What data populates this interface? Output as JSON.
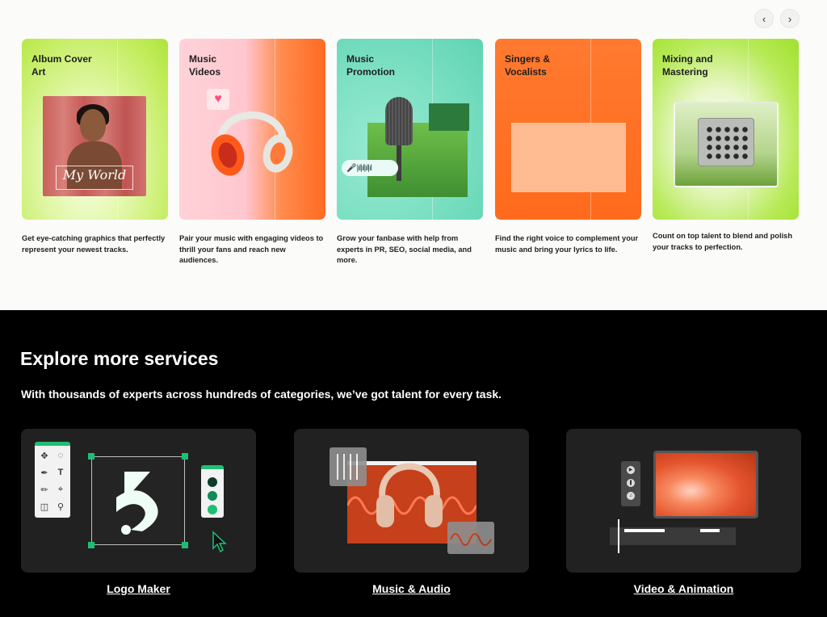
{
  "carousel": {
    "prev_icon": "chevron-left-icon",
    "next_icon": "chevron-right-icon",
    "cards": [
      {
        "title_line1": "Album Cover",
        "title_line2": "Art",
        "art_text": "My World",
        "description": "Get eye-catching graphics that perfectly represent your newest tracks."
      },
      {
        "title_line1": "Music",
        "title_line2": "Videos",
        "description": "Pair your music with engaging videos to thrill your fans and reach new audiences."
      },
      {
        "title_line1": "Music",
        "title_line2": "Promotion",
        "description": "Grow your fanbase with help from experts in PR, SEO, social media, and more."
      },
      {
        "title_line1": "Singers &",
        "title_line2": "Vocalists",
        "description": "Find the right voice to complement your music and bring your lyrics to life."
      },
      {
        "title_line1": "Mixing and",
        "title_line2": "Mastering",
        "description": "Count on top talent to blend and polish your tracks to perfection."
      }
    ]
  },
  "explore": {
    "heading": "Explore more services",
    "subheading": "With thousands of experts across hundreds of categories, we’ve got talent for every task.",
    "services": [
      {
        "label": "Logo Maker"
      },
      {
        "label": "Music & Audio"
      },
      {
        "label": "Video & Animation"
      }
    ]
  },
  "colors": {
    "accent_green": "#1dbf73",
    "dark_bg": "#000000",
    "card_bg": "#212121"
  }
}
